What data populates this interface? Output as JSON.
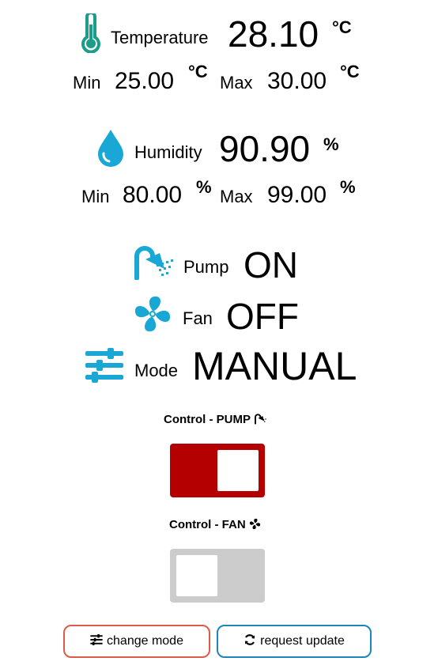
{
  "colors": {
    "accent": "#19a7d6",
    "thermo": "#1a9e8a",
    "switch_on": "#b50000",
    "switch_off": "#cccccc",
    "mode_button_border": "#e05a4a",
    "update_button_border": "#1b86b8"
  },
  "temperature": {
    "label": "Temperature",
    "value": "28.10",
    "unit": "°C",
    "min_label": "Min",
    "min_value": "25.00",
    "min_unit": "°C",
    "max_label": "Max",
    "max_value": "30.00",
    "max_unit": "°C",
    "icon": "thermometer-icon"
  },
  "humidity": {
    "label": "Humidity",
    "value": "90.90",
    "unit": "%",
    "min_label": "Min",
    "min_value": "80.00",
    "min_unit": "%",
    "max_label": "Max",
    "max_value": "99.00",
    "max_unit": "%",
    "icon": "water-drop-icon"
  },
  "pump": {
    "label": "Pump",
    "value": "ON",
    "icon": "shower-icon"
  },
  "fan": {
    "label": "Fan",
    "value": "OFF",
    "icon": "fan-icon"
  },
  "mode": {
    "label": "Mode",
    "value": "MANUAL",
    "icon": "sliders-icon"
  },
  "controls": {
    "pump_title": "Control - PUMP",
    "pump_state": "on",
    "fan_title": "Control - FAN",
    "fan_state": "off"
  },
  "buttons": {
    "change_mode": "change mode",
    "request_update": "request update"
  }
}
